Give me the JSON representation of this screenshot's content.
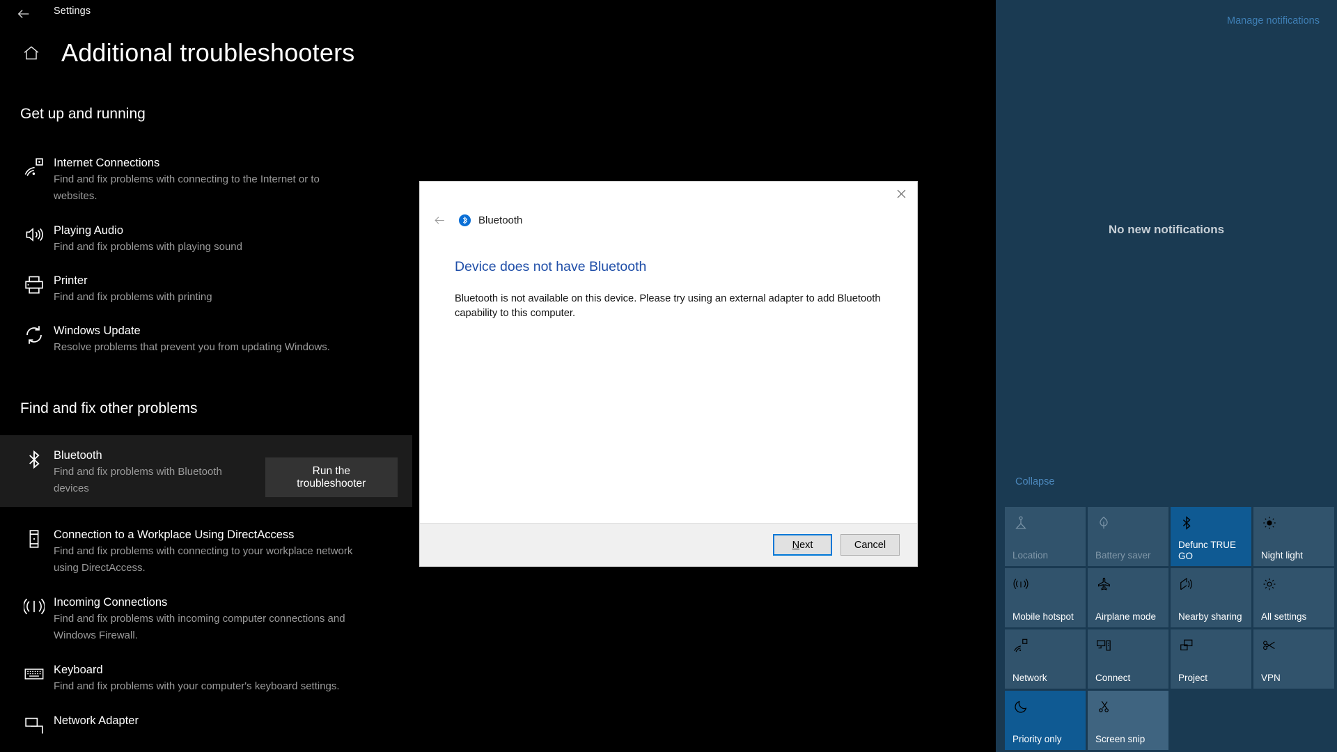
{
  "settings": {
    "window_title": "Settings",
    "back_icon": "back-arrow-icon",
    "home_icon": "home-icon",
    "page_title": "Additional troubleshooters",
    "sections": [
      {
        "heading": "Get up and running",
        "items": [
          {
            "icon": "internet-connections-icon",
            "name": "Internet Connections",
            "desc": "Find and fix problems with connecting to the Internet or to websites."
          },
          {
            "icon": "speaker-icon",
            "name": "Playing Audio",
            "desc": "Find and fix problems with playing sound"
          },
          {
            "icon": "printer-icon",
            "name": "Printer",
            "desc": "Find and fix problems with printing"
          },
          {
            "icon": "refresh-icon",
            "name": "Windows Update",
            "desc": "Resolve problems that prevent you from updating Windows."
          }
        ]
      },
      {
        "heading": "Find and fix other problems",
        "items": [
          {
            "icon": "bluetooth-icon",
            "name": "Bluetooth",
            "desc": "Find and fix problems with Bluetooth devices",
            "selected": true,
            "button": "Run the troubleshooter"
          },
          {
            "icon": "device-icon",
            "name": "Connection to a Workplace Using DirectAccess",
            "desc": "Find and fix problems with connecting to your workplace network using DirectAccess."
          },
          {
            "icon": "broadcast-icon",
            "name": "Incoming Connections",
            "desc": "Find and fix problems with incoming computer connections and Windows Firewall."
          },
          {
            "icon": "keyboard-icon",
            "name": "Keyboard",
            "desc": "Find and fix problems with your computer's keyboard settings."
          },
          {
            "icon": "network-adapter-icon",
            "name": "Network Adapter",
            "desc": ""
          }
        ]
      }
    ]
  },
  "dialog": {
    "close_icon": "close-icon",
    "back_icon": "back-arrow-icon",
    "nav_icon": "bluetooth-icon",
    "nav_label": "Bluetooth",
    "heading": "Device does not have Bluetooth",
    "body": "Bluetooth is not available on this device. Please try using an external adapter to add Bluetooth capability to this computer.",
    "next_label_prefix": "N",
    "next_label_rest": "ext",
    "cancel_label": "Cancel",
    "accent_color": "#0078d7",
    "heading_color": "#1f4ea8"
  },
  "action_center": {
    "manage_link": "Manage notifications",
    "empty_text": "No new notifications",
    "collapse_link": "Collapse",
    "background_color": "#1a3a52",
    "active_tile_color": "#0f5a93",
    "tiles": [
      {
        "icon": "location-icon",
        "label": "Location",
        "state": "disabled"
      },
      {
        "icon": "battery-saver-icon",
        "label": "Battery saver",
        "state": "disabled"
      },
      {
        "icon": "bluetooth-icon",
        "label": "Defunc TRUE GO",
        "state": "active"
      },
      {
        "icon": "brightness-icon",
        "label": "Night light",
        "state": "normal"
      },
      {
        "icon": "mobile-hotspot-icon",
        "label": "Mobile hotspot",
        "state": "normal"
      },
      {
        "icon": "airplane-icon",
        "label": "Airplane mode",
        "state": "normal"
      },
      {
        "icon": "nearby-sharing-icon",
        "label": "Nearby sharing",
        "state": "normal"
      },
      {
        "icon": "gear-icon",
        "label": "All settings",
        "state": "normal"
      },
      {
        "icon": "wifi-icon",
        "label": "Network",
        "state": "normal"
      },
      {
        "icon": "connect-icon",
        "label": "Connect",
        "state": "normal"
      },
      {
        "icon": "project-icon",
        "label": "Project",
        "state": "normal"
      },
      {
        "icon": "vpn-icon",
        "label": "VPN",
        "state": "normal"
      },
      {
        "icon": "moon-icon",
        "label": "Priority only",
        "state": "active"
      },
      {
        "icon": "screen-snip-icon",
        "label": "Screen snip",
        "state": "hover"
      }
    ]
  }
}
